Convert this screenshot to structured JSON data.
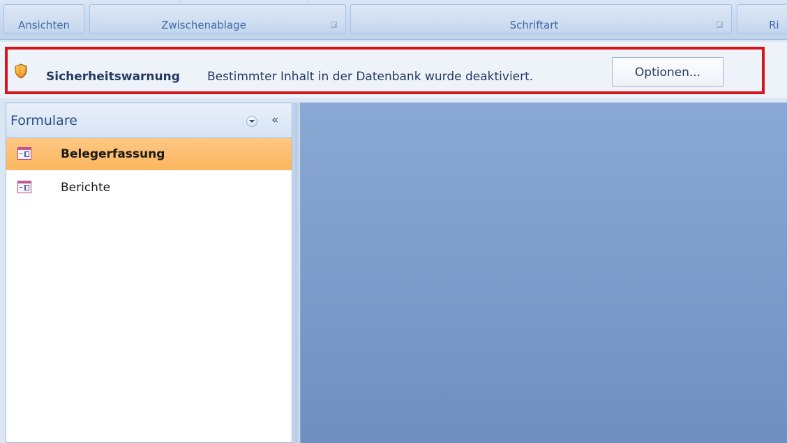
{
  "ribbon": {
    "groups": [
      {
        "label": "Ansichten"
      },
      {
        "label": "Zwischenablage"
      },
      {
        "label": "Schriftart"
      },
      {
        "label": "Ri"
      }
    ]
  },
  "security_bar": {
    "title": "Sicherheitswarnung",
    "message": "Bestimmter Inhalt in der Datenbank wurde deaktiviert.",
    "options_button": "Optionen..."
  },
  "nav_pane": {
    "title": "Formulare",
    "collapse_glyph": "«",
    "items": [
      {
        "label": "Belegerfassung",
        "selected": true
      },
      {
        "label": "Berichte",
        "selected": false
      }
    ]
  },
  "colors": {
    "highlight_border": "#d8141d",
    "selected_item": "#fcb65e",
    "workspace": "#7e9dcb"
  }
}
